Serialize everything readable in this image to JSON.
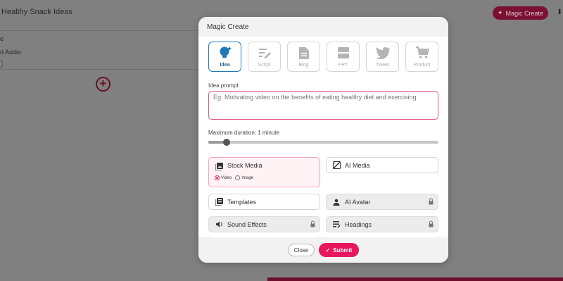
{
  "background": {
    "title": "Healthy Snack Ideas",
    "magic_create_label": "Magic Create",
    "row_label_e": "e",
    "row_label_audio": "d Audio"
  },
  "modal": {
    "title": "Magic Create",
    "types": [
      {
        "label": "Idea",
        "icon": "lightbulb-sparkle-icon",
        "active": true
      },
      {
        "label": "Script",
        "icon": "script-pen-icon",
        "active": false
      },
      {
        "label": "Blog",
        "icon": "document-icon",
        "active": false
      },
      {
        "label": "PPT",
        "icon": "slides-icon",
        "active": false
      },
      {
        "label": "Tweet",
        "icon": "bird-icon",
        "active": false
      },
      {
        "label": "Product",
        "icon": "cart-icon",
        "active": false
      }
    ],
    "prompt_label": "Idea prompt",
    "prompt_placeholder": "Eg: Motivating video on the benefits of eating healthy diet and exercising",
    "duration_label": "Maximum duration: 1 minute",
    "duration_fraction": 0.08,
    "options": {
      "stock_media": "Stock Media",
      "stock_video": "Video",
      "stock_image": "Image",
      "ai_media": "AI Media",
      "templates": "Templates",
      "ai_avatar": "AI Avatar",
      "sound_effects": "Sound Effects",
      "headings": "Headings"
    },
    "close_label": "Close",
    "submit_label": "Submit"
  },
  "colors": {
    "accent": "#e8175d",
    "active_type": "#1f7ab5",
    "prompt_border": "#e0557d"
  }
}
